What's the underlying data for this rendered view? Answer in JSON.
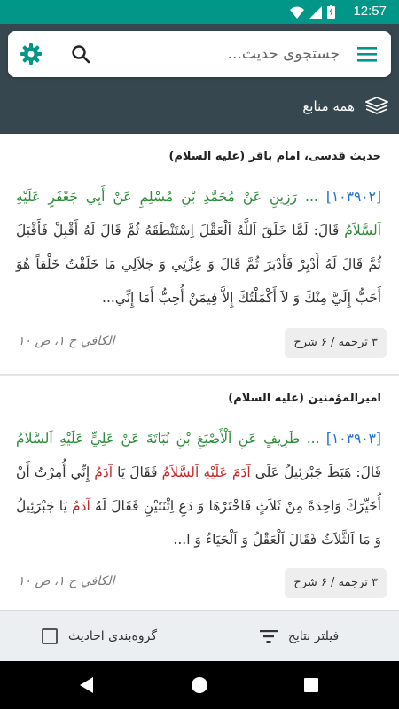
{
  "status_bar": {
    "time": "12:57"
  },
  "search": {
    "placeholder": "جستجوی حدیث..."
  },
  "sources": {
    "label": "همه منابع"
  },
  "hadiths": [
    {
      "source": "حدیث قدسی، امام باقر (علیه السلام)",
      "number": "[۱۰۳۹۰۲]",
      "chain": "... رَزِينٍ عَنْ  مُحَمَّدِ بْنِ مُسْلِمٍ عَنْ  أَبِي جَعْفَرٍ عَلَيْهِ اَلسَّلاَمُ",
      "text": " قَالَ: لَمَّا خَلَقَ اَللَّهُ اَلْعَقْلَ اِسْتَنْطَقَهُ ثُمَّ قَالَ لَهُ أَقْبِلْ فَأَقْبَلَ ثُمَّ قَالَ لَهُ أَدْبِرْ فَأَدْبَرَ ثُمَّ قَالَ وَ عِزَّتِي وَ جَلاَلِي مَا خَلَقْتُ خَلْقاً هُوَ أَحَبُّ إِلَيَّ مِنْكَ وَ لاَ أَكْمَلْتُكَ إِلاَّ فِيمَنْ أُحِبُّ أَمَا إِنِّي...",
      "translation_count": "۳ ترجمه / ۶ شرح",
      "reference": "الکافي ج ۱، ص ۱۰"
    },
    {
      "source": "امیرالمؤمنین (علیه السلام)",
      "number": "[۱۰۳۹۰۳]",
      "chain": "... طَرِيفٍ عَنِ  اَلْأَصْبَغِ بْنِ نُبَاتَةَ عَنْ  عَلِيٍّ عَلَيْهِ اَلسَّلاَمُ",
      "text_a": " قَالَ: هَبَطَ جَبْرَئِيلُ عَلَى ",
      "adam1": "آدَمَ عَلَيْهِ اَلسَّلاَمُ",
      "text_b": " فَقَالَ يَا ",
      "adam2": "آدَمُ",
      "text_c": " إِنِّي أُمِرْتُ أَنْ أُخَيِّرَكَ وَاحِدَةً مِنْ ثَلاَثٍ فَاخْتَرْهَا وَ دَعِ اِثْنَتَيْنِ فَقَالَ لَهُ ",
      "adam3": "آدَمُ",
      "text_d": " يَا  جَبْرَئِيلُ وَ مَا اَلثَّلاَثُ فَقَالَ اَلْعَقْلُ وَ اَلْحَيَاءُ وَ ا...",
      "translation_count": "۳ ترجمه / ۶ شرح",
      "reference": "الکافي ج ۱، ص ۱۰"
    }
  ],
  "actions": {
    "filter_label": "فیلتر نتایج",
    "group_label": "گروه‌بندی احادیث"
  },
  "colors": {
    "accent": "#009688",
    "header": "#37474f",
    "number": "#1e6fd0",
    "narrator": "#2e8b3a",
    "highlight": "#c62828"
  }
}
